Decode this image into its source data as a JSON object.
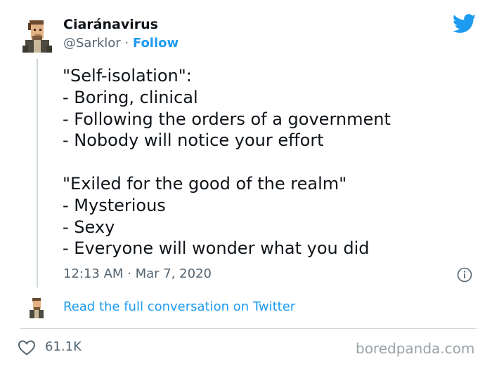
{
  "tweet": {
    "author": {
      "display_name": "Ciaránavirus",
      "handle": "@Sarklor",
      "separator": " · ",
      "follow_label": "Follow",
      "avatar_icon": "pixel-portrait-avatar"
    },
    "brand_icon": "twitter-bird-icon",
    "body_lines": [
      "\"Self-isolation\":",
      "- Boring, clinical",
      "- Following the orders of a government",
      "- Nobody will notice your effort",
      "",
      "\"Exiled for the good of the realm\"",
      "- Mysterious",
      "- Sexy",
      "- Everyone will wonder what you did"
    ],
    "timestamp": "12:13 AM · Mar 7, 2020",
    "conversation_link": "Read the full conversation on Twitter",
    "likes": "61.1K",
    "watermark": "boredpanda.com"
  },
  "colors": {
    "accent": "#1d9bf0",
    "text": "#0f1419",
    "secondary": "#536471",
    "divider": "#cfd9de"
  }
}
